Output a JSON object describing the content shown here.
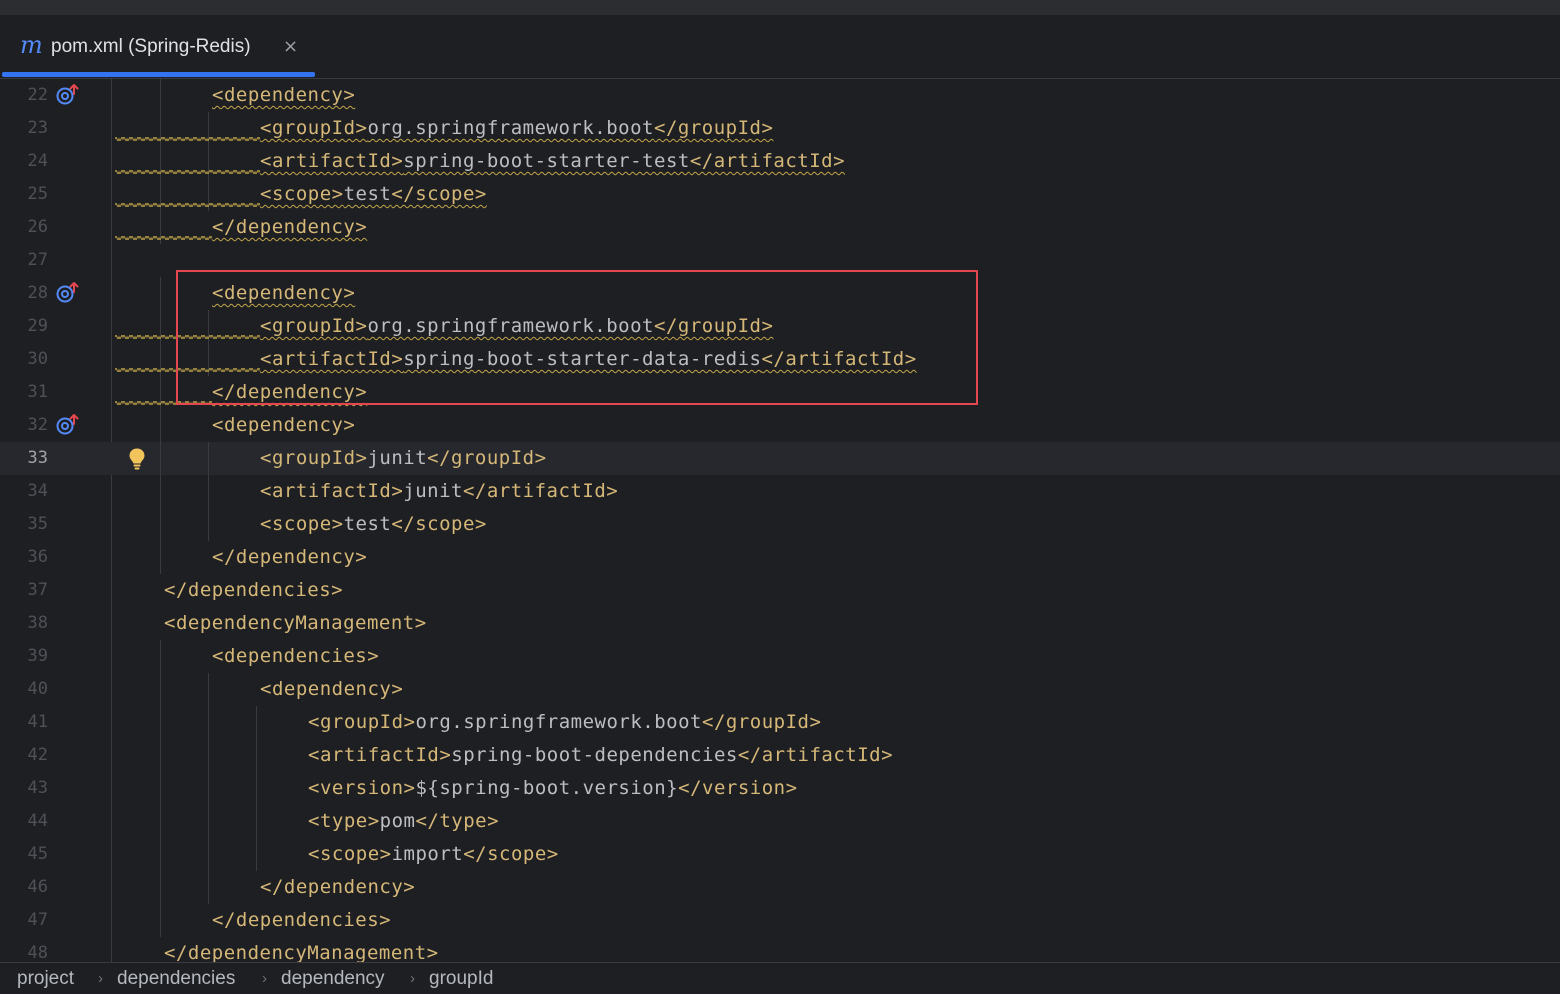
{
  "tab": {
    "icon": "maven-m-icon",
    "icon_glyph": "m",
    "title": "pom.xml (Spring-Redis)",
    "close_glyph": "×"
  },
  "editor": {
    "current_line": 33,
    "lines": [
      {
        "num": "22",
        "indent": 2,
        "parts": [
          [
            "tag",
            "<dependency>"
          ]
        ],
        "wavy": true,
        "icon": "override-icon"
      },
      {
        "num": "23",
        "indent": 3,
        "parts": [
          [
            "tag",
            "<groupId>"
          ],
          [
            "txt",
            "org.springframework.boot"
          ],
          [
            "tag",
            "</groupId>"
          ]
        ],
        "wavy": true,
        "leftwave": true
      },
      {
        "num": "24",
        "indent": 3,
        "parts": [
          [
            "tag",
            "<artifactId>"
          ],
          [
            "txt",
            "spring-boot-starter-test"
          ],
          [
            "tag",
            "</artifactId>"
          ]
        ],
        "wavy": true,
        "leftwave": true
      },
      {
        "num": "25",
        "indent": 3,
        "parts": [
          [
            "tag",
            "<scope>"
          ],
          [
            "txt",
            "test"
          ],
          [
            "tag",
            "</scope>"
          ]
        ],
        "wavy": true,
        "leftwave": true
      },
      {
        "num": "26",
        "indent": 2,
        "parts": [
          [
            "tag",
            "</dependency>"
          ]
        ],
        "wavy": true,
        "leftwave": true
      },
      {
        "num": "27",
        "indent": 0,
        "parts": []
      },
      {
        "num": "28",
        "indent": 2,
        "parts": [
          [
            "tag",
            "<dependency>"
          ]
        ],
        "wavy": true,
        "icon": "override-icon"
      },
      {
        "num": "29",
        "indent": 3,
        "parts": [
          [
            "tag",
            "<groupId>"
          ],
          [
            "txt",
            "org.springframework.boot"
          ],
          [
            "tag",
            "</groupId>"
          ]
        ],
        "wavy": true,
        "leftwave": true
      },
      {
        "num": "30",
        "indent": 3,
        "parts": [
          [
            "tag",
            "<artifactId>"
          ],
          [
            "txt",
            "spring-boot-starter-data-redis"
          ],
          [
            "tag",
            "</artifactId>"
          ]
        ],
        "wavy": true,
        "leftwave": true
      },
      {
        "num": "31",
        "indent": 2,
        "parts": [
          [
            "tag",
            "</dependency>"
          ]
        ],
        "wavy": true,
        "leftwave": true
      },
      {
        "num": "32",
        "indent": 2,
        "parts": [
          [
            "tag",
            "<dependency>"
          ]
        ],
        "icon": "override-icon"
      },
      {
        "num": "33",
        "indent": 3,
        "parts": [
          [
            "tag",
            "<groupId>"
          ],
          [
            "txt",
            "junit"
          ],
          [
            "tag",
            "</groupId>"
          ]
        ],
        "bulb": true
      },
      {
        "num": "34",
        "indent": 3,
        "parts": [
          [
            "tag",
            "<artifactId>"
          ],
          [
            "txt",
            "junit"
          ],
          [
            "tag",
            "</artifactId>"
          ]
        ]
      },
      {
        "num": "35",
        "indent": 3,
        "parts": [
          [
            "tag",
            "<scope>"
          ],
          [
            "txt",
            "test"
          ],
          [
            "tag",
            "</scope>"
          ]
        ]
      },
      {
        "num": "36",
        "indent": 2,
        "parts": [
          [
            "tag",
            "</dependency>"
          ]
        ]
      },
      {
        "num": "37",
        "indent": 1,
        "parts": [
          [
            "tag",
            "</dependencies>"
          ]
        ]
      },
      {
        "num": "38",
        "indent": 1,
        "parts": [
          [
            "tag",
            "<dependencyManagement>"
          ]
        ]
      },
      {
        "num": "39",
        "indent": 2,
        "parts": [
          [
            "tag",
            "<dependencies>"
          ]
        ]
      },
      {
        "num": "40",
        "indent": 3,
        "parts": [
          [
            "tag",
            "<dependency>"
          ]
        ]
      },
      {
        "num": "41",
        "indent": 4,
        "parts": [
          [
            "tag",
            "<groupId>"
          ],
          [
            "txt",
            "org.springframework.boot"
          ],
          [
            "tag",
            "</groupId>"
          ]
        ]
      },
      {
        "num": "42",
        "indent": 4,
        "parts": [
          [
            "tag",
            "<artifactId>"
          ],
          [
            "txt",
            "spring-boot-dependencies"
          ],
          [
            "tag",
            "</artifactId>"
          ]
        ]
      },
      {
        "num": "43",
        "indent": 4,
        "parts": [
          [
            "tag",
            "<version>"
          ],
          [
            "txt",
            "${spring-boot.version}"
          ],
          [
            "tag",
            "</version>"
          ]
        ]
      },
      {
        "num": "44",
        "indent": 4,
        "parts": [
          [
            "tag",
            "<type>"
          ],
          [
            "txt",
            "pom"
          ],
          [
            "tag",
            "</type>"
          ]
        ]
      },
      {
        "num": "45",
        "indent": 4,
        "parts": [
          [
            "tag",
            "<scope>"
          ],
          [
            "txt",
            "import"
          ],
          [
            "tag",
            "</scope>"
          ]
        ]
      },
      {
        "num": "46",
        "indent": 3,
        "parts": [
          [
            "tag",
            "</dependency>"
          ]
        ]
      },
      {
        "num": "47",
        "indent": 2,
        "parts": [
          [
            "tag",
            "</dependencies>"
          ]
        ]
      },
      {
        "num": "48",
        "indent": 1,
        "parts": [
          [
            "tag",
            "</dependencyManagement>"
          ]
        ]
      }
    ]
  },
  "breadcrumbs": [
    "project",
    "dependencies",
    "dependency",
    "groupId"
  ],
  "breadcrumb_separator": "›",
  "colors": {
    "background": "#1e1f22",
    "tag": "#d5b778",
    "text": "#bcbec4",
    "line_number": "#4e5157",
    "accent": "#3574f0",
    "highlight_box": "#e5474f",
    "warning_wave": "#c3a54a"
  }
}
